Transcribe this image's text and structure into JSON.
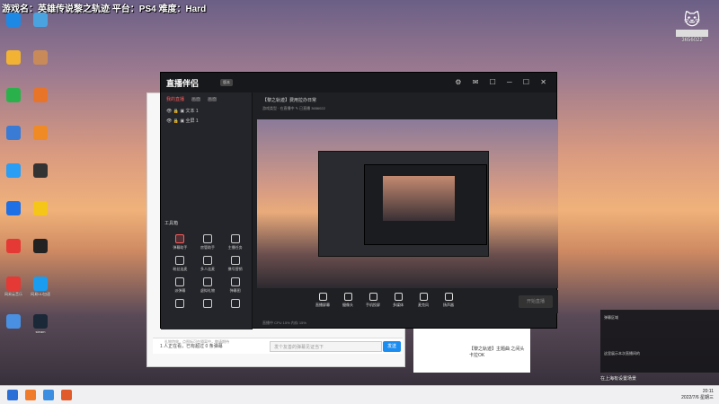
{
  "overlay": {
    "text": "游戏名：英雄传说黎之轨迹 平台：PS4 难度：Hard"
  },
  "desktop": {
    "icons": [
      {
        "label": "",
        "icon": "qq-icon"
      },
      {
        "label": "",
        "icon": "recycle-bin-icon"
      },
      {
        "label": "",
        "icon": "folder-icon"
      },
      {
        "label": "",
        "icon": "game-icon"
      },
      {
        "label": "",
        "icon": "green-plus-icon"
      },
      {
        "label": "",
        "icon": "bird-icon"
      },
      {
        "label": "",
        "icon": "app-icon"
      },
      {
        "label": "",
        "icon": "orange-app-icon"
      },
      {
        "label": "",
        "icon": "blue-app-icon"
      },
      {
        "label": "",
        "icon": "obs-icon"
      },
      {
        "label": "",
        "icon": "feishu-icon"
      },
      {
        "label": "",
        "icon": "yellow-app-icon"
      },
      {
        "label": "",
        "icon": "red-app-icon"
      },
      {
        "label": "",
        "icon": "capcut-icon"
      },
      {
        "label": "网易云音乐",
        "icon": "netease-music-icon"
      },
      {
        "label": "网易UU加速",
        "icon": "uu-icon"
      },
      {
        "label": "",
        "icon": "image-icon"
      },
      {
        "label": "steam",
        "icon": "steam-icon"
      }
    ]
  },
  "streamer": {
    "id": "3656022"
  },
  "app": {
    "logo": "直播伴侣",
    "tabs": [
      "我的直播",
      "画面",
      "画面"
    ],
    "scenes": [
      "文本 1",
      "全屏 1"
    ],
    "tools_title": "工具箱",
    "tools": [
      "弹幕助手",
      "房管助手",
      "主播任务",
      "粉丝连麦",
      "多人连麦",
      "携号营销",
      "派弹幕",
      "虚拟礼物",
      "弹幕图",
      "",
      "",
      ""
    ],
    "notice": "礼物特效，点图标可在隔离中，敬请期待",
    "room_title": "【黎之轨迹】费用拉办日常",
    "room_tag": "直播",
    "room_sub": "游戏类型 · 在直播中 ✎  已直播 3656022",
    "preview_overlay": "游戏名：英雄传说黎之轨迹 平台：PS4 难度：Hard",
    "toolbar": [
      "直播屏幕",
      "摄像头",
      "手机投屏",
      "多媒体",
      "麦克风",
      "扬声器"
    ],
    "live_button": "开始直播",
    "status": "直播中    CPU 15%    内存 15%"
  },
  "browser": {
    "chat_count": "1 人正在看，已有超过 0 条弹幕",
    "chat_placeholder": "发个友善的弹幕见证当下",
    "send": "发送",
    "card_text": "【黎之轨迹】主题曲  之间头 卡拉OK"
  },
  "right_panel": {
    "title": "弹幕区域",
    "danmaku": "在上海有设置场景",
    "summary": "这里展示本次直播间的"
  },
  "clock": {
    "time": "20:11",
    "date": "2022/7/6 星期三"
  }
}
